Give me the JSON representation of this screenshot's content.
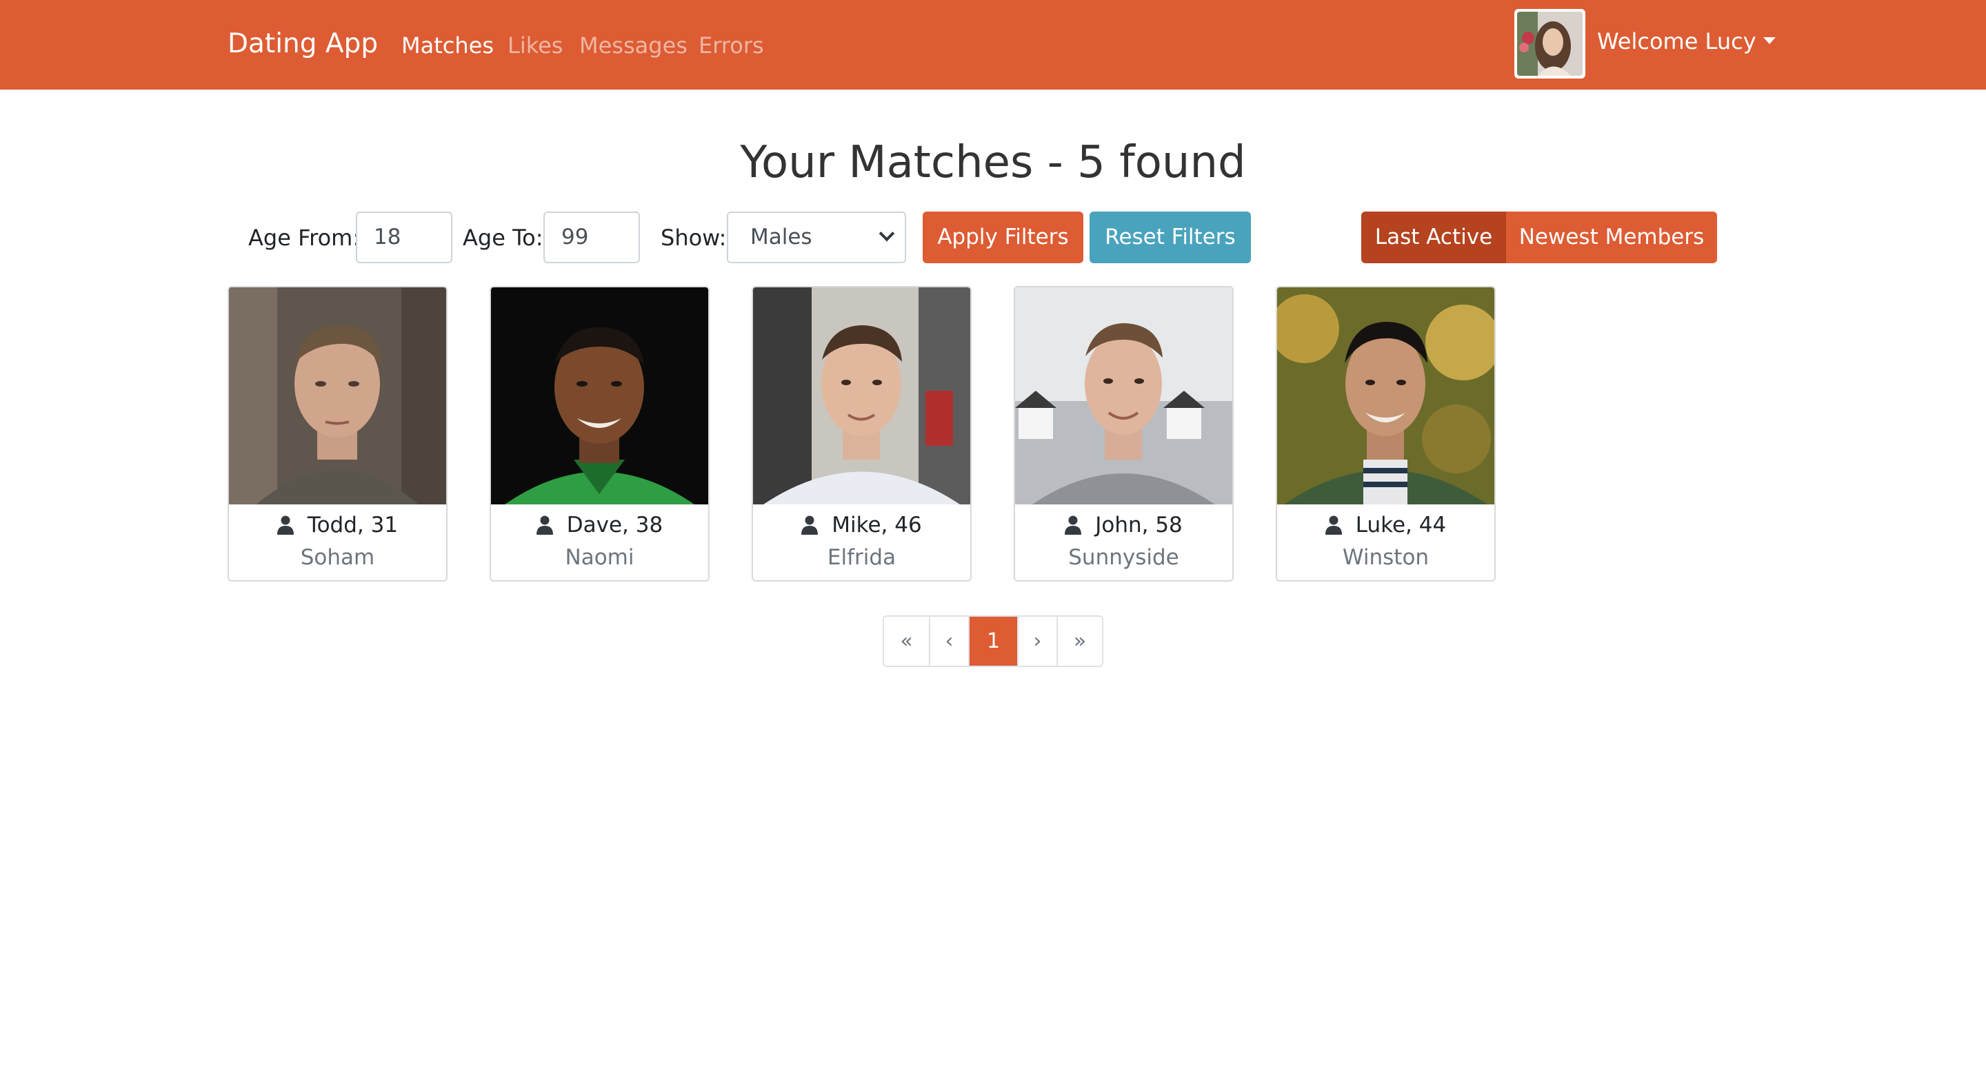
{
  "navbar": {
    "brand": "Dating App",
    "links": [
      {
        "label": "Matches",
        "active": true
      },
      {
        "label": "Likes",
        "active": false
      },
      {
        "label": "Messages",
        "active": false
      },
      {
        "label": "Errors",
        "active": false
      }
    ],
    "welcome": "Welcome Lucy",
    "colors": {
      "background": "#dd5c33",
      "text": "#ffffff"
    }
  },
  "page": {
    "title": "Your Matches - 5 found"
  },
  "filters": {
    "age_from_label": "Age From:",
    "age_from_value": "18",
    "age_to_label": "Age To:",
    "age_to_value": "99",
    "show_label": "Show:",
    "show_selected": "Males",
    "apply_label": "Apply Filters",
    "reset_label": "Reset Filters",
    "sort": {
      "last_active": "Last Active",
      "newest_members": "Newest Members",
      "selected": "Last Active"
    }
  },
  "members": [
    {
      "name": "Todd, 31",
      "city": "Soham",
      "icon": "user-icon"
    },
    {
      "name": "Dave, 38",
      "city": "Naomi",
      "icon": "user-icon"
    },
    {
      "name": "Mike, 46",
      "city": "Elfrida",
      "icon": "user-icon"
    },
    {
      "name": "John, 58",
      "city": "Sunnyside",
      "icon": "user-icon"
    },
    {
      "name": "Luke, 44",
      "city": "Winston",
      "icon": "user-icon"
    }
  ],
  "pagination": {
    "first": "«",
    "prev": "‹",
    "current": "1",
    "next": "›",
    "last": "»"
  },
  "colors": {
    "primary": "#dd5c33",
    "primary_active": "#b5431f",
    "info": "#4aa3bd",
    "muted": "#6c757d"
  }
}
